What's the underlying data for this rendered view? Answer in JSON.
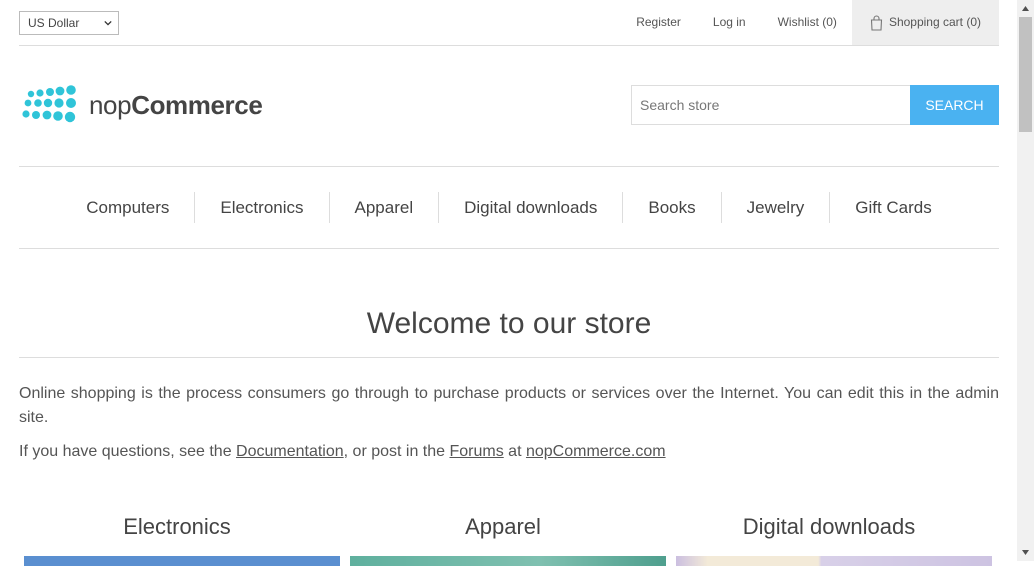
{
  "header": {
    "currency": "US Dollar",
    "links": {
      "register": "Register",
      "login": "Log in",
      "wishlist": "Wishlist (0)",
      "cart": "Shopping cart (0)"
    }
  },
  "logo": {
    "light": "nop",
    "bold": "Commerce"
  },
  "search": {
    "placeholder": "Search store",
    "button": "SEARCH"
  },
  "menu": [
    "Computers",
    "Electronics",
    "Apparel",
    "Digital downloads",
    "Books",
    "Jewelry",
    "Gift Cards"
  ],
  "welcome": {
    "title": "Welcome to our store",
    "intro": "Online shopping is the process consumers go through to purchase products or services over the Internet. You can edit this in the admin site.",
    "links_prefix": "If you have questions, see the ",
    "documentation": "Documentation",
    "links_mid": ", or post in the ",
    "forums": "Forums",
    "links_at": " at ",
    "site": "nopCommerce.com"
  },
  "categories": [
    "Electronics",
    "Apparel",
    "Digital downloads"
  ],
  "colors": {
    "accent": "#4ab2f1",
    "logo": "#2fc4d8"
  }
}
